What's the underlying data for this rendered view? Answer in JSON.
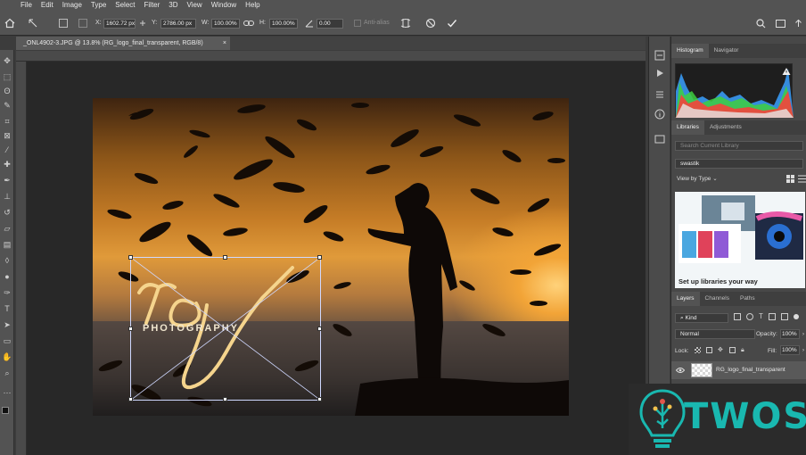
{
  "menu": [
    "File",
    "Edit",
    "Image",
    "Type",
    "Select",
    "Filter",
    "3D",
    "View",
    "Window",
    "Help"
  ],
  "options": {
    "x_label": "X:",
    "x_value": "1602.72 px",
    "y_label": "Y:",
    "y_value": "2786.00 px",
    "w_label": "W:",
    "w_value": "100.00%",
    "h_label": "H:",
    "h_value": "100.00%",
    "angle_value": "0.00",
    "antialias_label": "Anti-alias"
  },
  "document_tab": {
    "title": "_ONL4902-3.JPG @ 13.8% (RG_logo_final_transparent, RGB/8)",
    "close": "×"
  },
  "logo": {
    "script_text": "rg",
    "sub_text": "PHOTOGRAPHY"
  },
  "panels": {
    "histogram_tabs": [
      "Histogram",
      "Navigator"
    ],
    "library_tabs": [
      "Libraries",
      "Adjustments"
    ],
    "library_search_placeholder": "Search Current Library",
    "library_name": "swastik",
    "view_by_type": "View by Type",
    "library_card_caption": "Set up libraries your way",
    "layers_tabs": [
      "Layers",
      "Channels",
      "Paths"
    ],
    "kind_filter": "Kind",
    "blend_mode": "Normal",
    "opacity_label": "Opacity:",
    "opacity_value": "100%",
    "lock_label": "Lock:",
    "fill_label": "Fill:",
    "fill_value": "100%",
    "layer_name": "RG_logo_final_transparent"
  },
  "watermark": {
    "text": "TWOS"
  },
  "colors": {
    "accent": "#19b8b0",
    "chrome": "#535353",
    "workspace": "#282828"
  }
}
